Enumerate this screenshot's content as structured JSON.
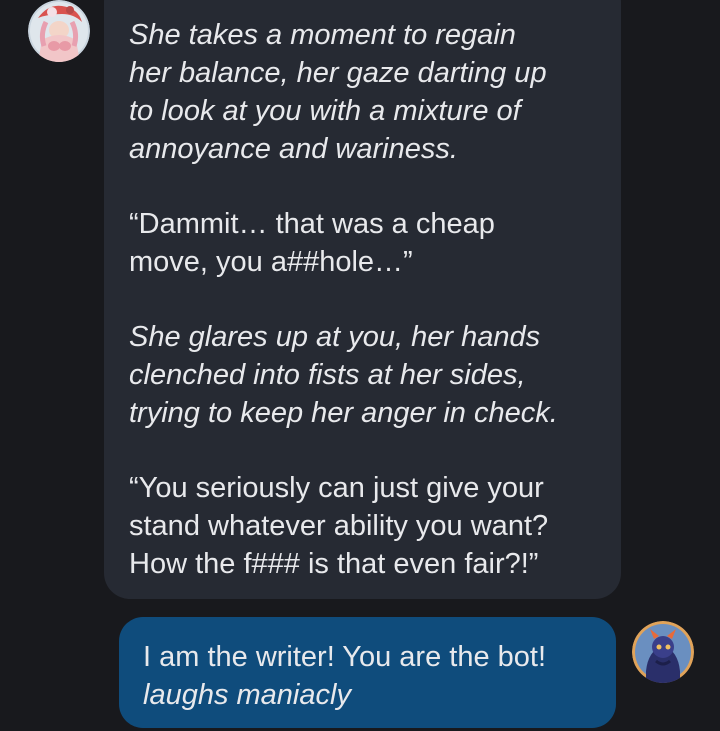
{
  "bot_message": {
    "paragraphs": [
      {
        "text": "She takes a moment to regain\nher balance, her gaze darting up\nto look at you with a mixture of\nannoyance and wariness.",
        "style": "italic"
      },
      {
        "text": "“Dammit… that was a cheap\nmove, you a##hole…”",
        "style": "normal"
      },
      {
        "text": "She glares up at you, her hands\nclenched into fists at her sides,\ntrying to keep her anger in check.",
        "style": "italic"
      },
      {
        "text": "“You seriously can just give your\nstand whatever ability you want?\nHow the f### is that even fair?!”",
        "style": "normal"
      }
    ],
    "avatar_icon": "bot-avatar-icon",
    "bubble_color": "#262a33"
  },
  "user_message": {
    "line1": "I am the writer! You are the bot!",
    "line2": "laughs maniacly",
    "avatar_icon": "user-avatar-icon",
    "bubble_color": "#0f4c7c"
  },
  "colors": {
    "background": "#18191d",
    "text": "#e8e9ec"
  }
}
